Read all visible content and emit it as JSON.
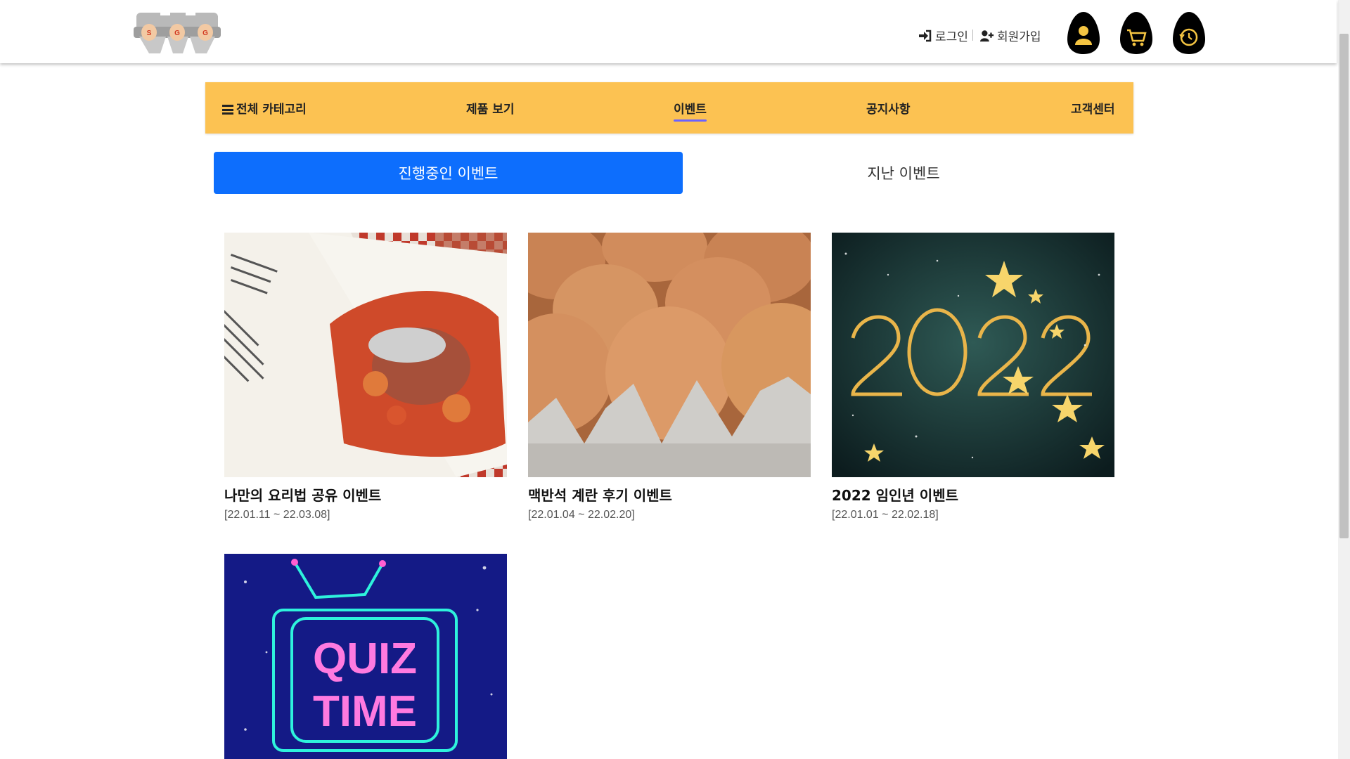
{
  "header": {
    "logo_letters": [
      "S",
      "G",
      "G"
    ],
    "login_label": "로그인",
    "signup_label": "회원가입",
    "icons": [
      "mypage-egg-icon",
      "cart-egg-icon",
      "recent-egg-icon"
    ]
  },
  "nav": {
    "items": [
      {
        "label": "전체 카테고리",
        "icon": "hamburger-icon"
      },
      {
        "label": "제품 보기"
      },
      {
        "label": "이벤트",
        "active": true
      },
      {
        "label": "공지사항"
      },
      {
        "label": "고객센터"
      }
    ]
  },
  "tabs": {
    "ongoing": "진행중인 이벤트",
    "past": "지난 이벤트"
  },
  "events": [
    {
      "title": "나만의 요리법 공유 이벤트",
      "date": "[22.01.11 ~ 22.03.08]"
    },
    {
      "title": "맥반석 계란 후기 이벤트",
      "date": "[22.01.04 ~ 22.02.20]"
    },
    {
      "title": "2022 임인년 이벤트",
      "date": "[22.01.01 ~ 22.02.18]"
    },
    {
      "title": "",
      "date": "",
      "image_text": [
        "QUIZ",
        "TIME"
      ]
    }
  ],
  "colors": {
    "nav_bg": "#fcc252",
    "tab_active_bg": "#0d6efd",
    "nav_active_underline": "#6c63ff"
  }
}
